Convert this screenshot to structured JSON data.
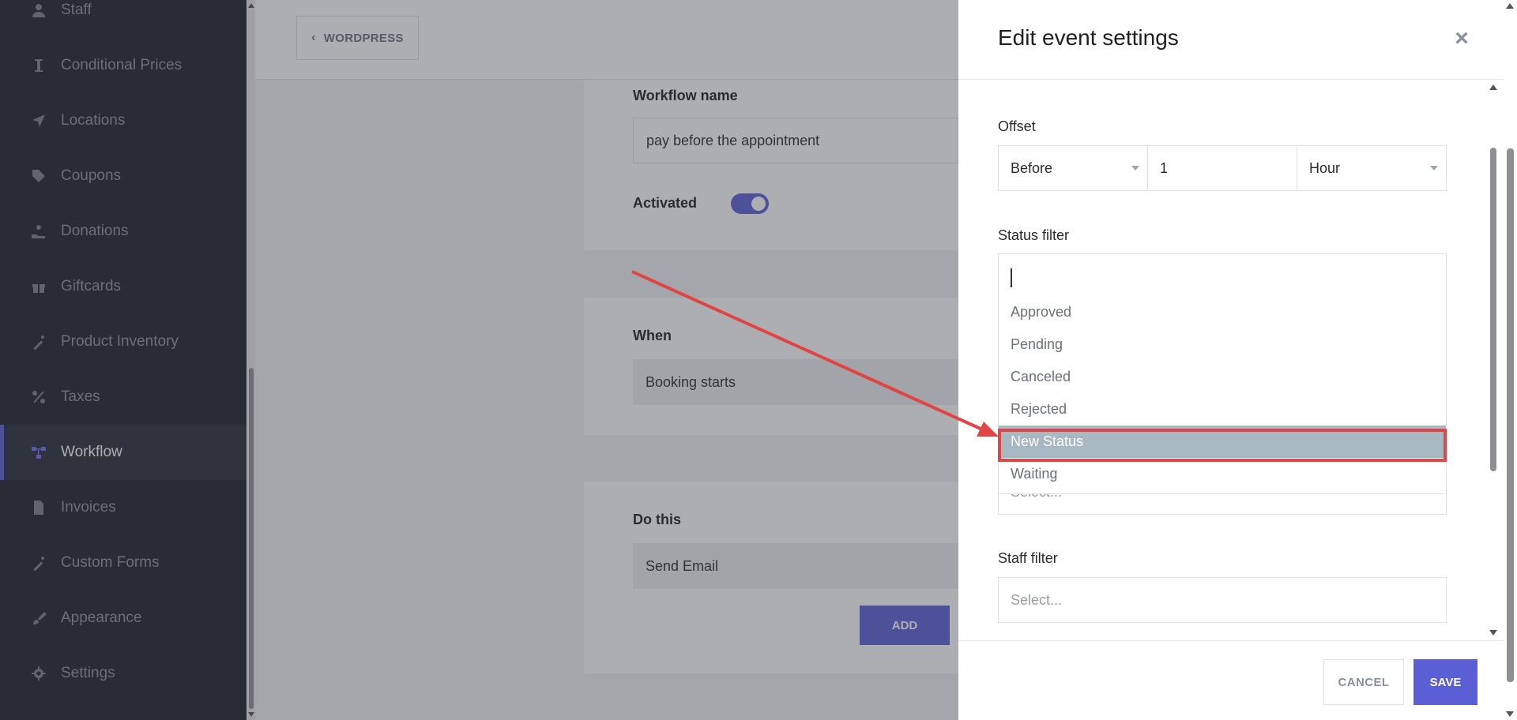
{
  "sidebar": {
    "items": [
      {
        "label": "Staff",
        "icon": "user-icon",
        "active": false
      },
      {
        "label": "Conditional Prices",
        "icon": "cursor-icon",
        "active": false
      },
      {
        "label": "Locations",
        "icon": "location-arrow-icon",
        "active": false
      },
      {
        "label": "Coupons",
        "icon": "tag-icon",
        "active": false
      },
      {
        "label": "Donations",
        "icon": "hand-donate-icon",
        "active": false
      },
      {
        "label": "Giftcards",
        "icon": "gift-icon",
        "active": false
      },
      {
        "label": "Product Inventory",
        "icon": "magic-wand-icon",
        "active": false
      },
      {
        "label": "Taxes",
        "icon": "percent-icon",
        "active": false
      },
      {
        "label": "Workflow",
        "icon": "workflow-icon",
        "active": true
      },
      {
        "label": "Invoices",
        "icon": "file-icon",
        "active": false
      },
      {
        "label": "Custom Forms",
        "icon": "magic-wand-icon",
        "active": false
      },
      {
        "label": "Appearance",
        "icon": "brush-icon",
        "active": false
      },
      {
        "label": "Settings",
        "icon": "gear-icon",
        "active": false
      }
    ]
  },
  "topbar": {
    "back_label": "WORDPRESS"
  },
  "main": {
    "workflow_name_label": "Workflow name",
    "workflow_name_value": "pay before the appointment",
    "activated_label": "Activated",
    "activated": true,
    "when_label": "When",
    "when_value": "Booking starts",
    "do_this_label": "Do this",
    "do_this_value": "Send Email",
    "add_label": "ADD"
  },
  "panel": {
    "title": "Edit event settings",
    "offset_label": "Offset",
    "offset_direction": "Before",
    "offset_amount": "1",
    "offset_unit": "Hour",
    "status_filter_label": "Status filter",
    "status_options": [
      "Approved",
      "Pending",
      "Canceled",
      "Rejected",
      "New Status",
      "Waiting"
    ],
    "status_highlighted": "New Status",
    "hidden_select_placeholder": "Select...",
    "staff_filter_label": "Staff filter",
    "staff_placeholder": "Select...",
    "cancel_label": "CANCEL",
    "save_label": "SAVE"
  },
  "colors": {
    "accent": "#5a5fd6",
    "sidebar_bg": "#1b1f2b",
    "highlight_option": "#a7b8c2",
    "annotation_red": "#e04545"
  }
}
